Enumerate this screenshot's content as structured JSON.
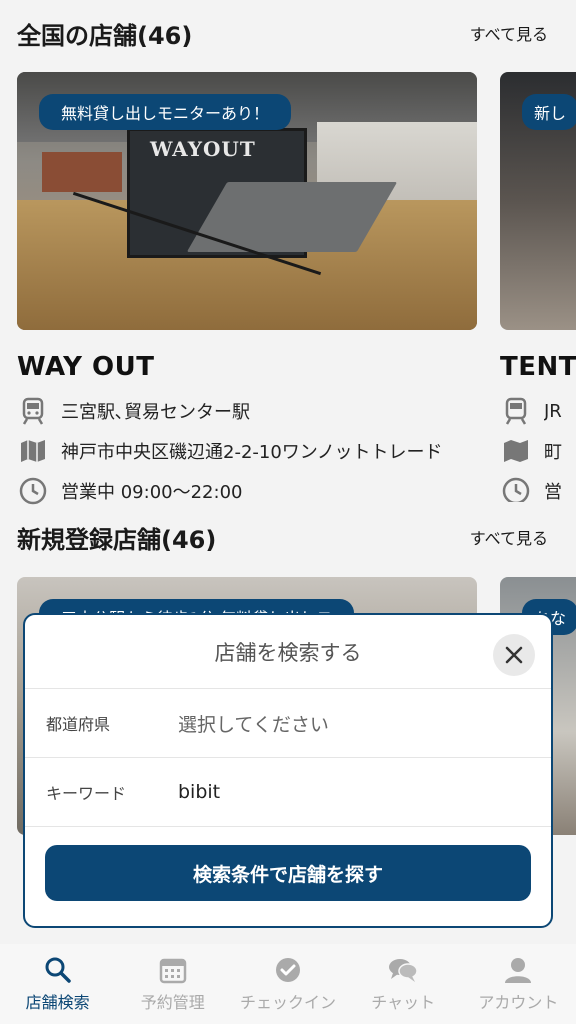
{
  "sections": [
    {
      "title": "全国の店舗(46)",
      "see_all": "すべて見る"
    },
    {
      "title": "新規登録店舗(46)",
      "see_all": "すべて見る"
    }
  ],
  "stores": [
    {
      "badge": "無料貸し出しモニターあり！",
      "image_text": "WAYOUT",
      "name": "WAY OUT",
      "station": "三宮駅､貿易センター駅",
      "address": "神戸市中央区磯辺通2-2-10ワンノットトレード",
      "hours": "営業中 09:00〜22:00"
    },
    {
      "badge": "新し",
      "name": "TENT",
      "station": "JR",
      "address": "町",
      "hours": "営"
    }
  ],
  "new_stores": [
    {
      "badge": "三木公駅から徒歩1分 無料貸し出しモ"
    },
    {
      "badge": "ちな"
    }
  ],
  "search_modal": {
    "title": "店舗を検索する",
    "prefecture_label": "都道府県",
    "prefecture_placeholder": "選択してください",
    "keyword_label": "キーワード",
    "keyword_value": "bibit",
    "submit_label": "検索条件で店舗を探す"
  },
  "bottom_nav": [
    {
      "label": "店舗検索",
      "icon": "search-icon",
      "active": true
    },
    {
      "label": "予約管理",
      "icon": "calendar-icon",
      "active": false
    },
    {
      "label": "チェックイン",
      "icon": "check-circle-icon",
      "active": false
    },
    {
      "label": "チャット",
      "icon": "chat-icon",
      "active": false
    },
    {
      "label": "アカウント",
      "icon": "account-icon",
      "active": false
    }
  ],
  "colors": {
    "brand": "#0c4775",
    "inactive": "#aaaaaa"
  }
}
